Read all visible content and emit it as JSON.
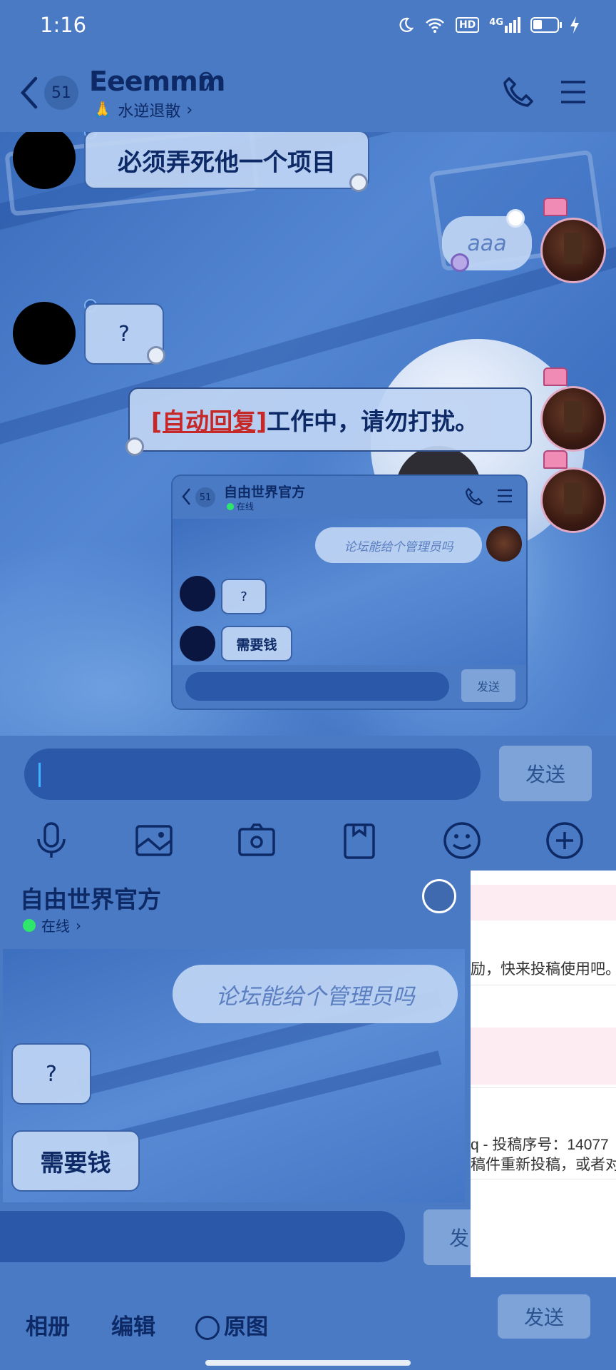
{
  "status_bar": {
    "time": "1:16",
    "icons": [
      "moon-icon",
      "wifi-icon",
      "hd-icon",
      "signal-4g-icon",
      "battery-icon",
      "charging-icon"
    ],
    "hd_label": "HD",
    "network_label": "4G"
  },
  "header": {
    "unread_count": "51",
    "contact_name": "Eeemmm",
    "status_text": "水逆退散",
    "status_emoji": "🙏"
  },
  "messages": [
    {
      "side": "left",
      "text": "必须弄死他一个项目"
    },
    {
      "side": "right",
      "text": "aaa"
    },
    {
      "side": "left",
      "text": "?"
    },
    {
      "side": "right",
      "autoreply_tag": "[自动回复]",
      "text": "工作中，请勿打扰。"
    }
  ],
  "embedded_screenshot": {
    "unread_count": "51",
    "contact_name": "自由世界官方",
    "status_text": "在线",
    "messages": [
      {
        "side": "right",
        "text": "论坛能给个管理员吗"
      },
      {
        "side": "left",
        "text": "?"
      },
      {
        "side": "left",
        "text": "需要钱"
      }
    ],
    "send_label": "发送"
  },
  "input": {
    "value": "",
    "send_label": "发送"
  },
  "toolbar": {
    "items": [
      "microphone-icon",
      "image-icon",
      "camera-icon",
      "file-icon",
      "emoji-icon",
      "plus-icon"
    ]
  },
  "preview": {
    "contact_name": "自由世界官方",
    "status_text": "在线",
    "messages": [
      {
        "side": "right",
        "text": "论坛能给个管理员吗"
      },
      {
        "side": "left",
        "text": "?"
      },
      {
        "side": "left",
        "text": "需要钱"
      }
    ],
    "send_label_partial": "发",
    "right_panel": {
      "line1": "励，快来投稿使用吧。",
      "line2": "q - 投稿序号：14077",
      "line3": "稿件重新投稿，或者对"
    }
  },
  "bottom_bar": {
    "album_label": "相册",
    "edit_label": "编辑",
    "original_label": "原图",
    "send_label": "发送"
  },
  "colors": {
    "primary_bg": "#4a7ac4",
    "bubble_bg": "#bed4f3",
    "text_dark": "#0d2a66",
    "autoreply_red": "#c62828",
    "online_green": "#2ee66b"
  }
}
